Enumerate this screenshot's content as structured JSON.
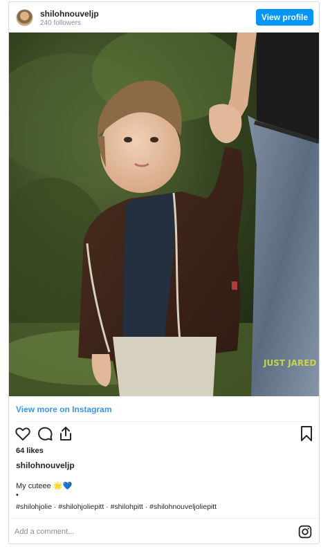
{
  "post": {
    "username": "shilohnouveljp",
    "followers": "240 followers",
    "view_profile": "View profile",
    "view_more": "View more on Instagram",
    "likes": "64 likes",
    "caption_text": "My cuteee 🌟💙",
    "bullet": "•",
    "hashtags": "#shilohjolie · #shilohjoliepitt · #shilohpitt · #shilohnouveljoliepitt",
    "photo_watermark": "JUST JARED"
  },
  "comment": {
    "placeholder": "Add a comment..."
  },
  "icons": {
    "like": "heart-icon",
    "comment": "comment-icon",
    "share": "share-icon",
    "save": "bookmark-icon",
    "brand": "instagram-icon"
  },
  "colors": {
    "accent": "#0095f6",
    "link": "#3897f0",
    "text": "#262626",
    "muted": "#8e8e8e",
    "border": "#dbdbdb"
  }
}
